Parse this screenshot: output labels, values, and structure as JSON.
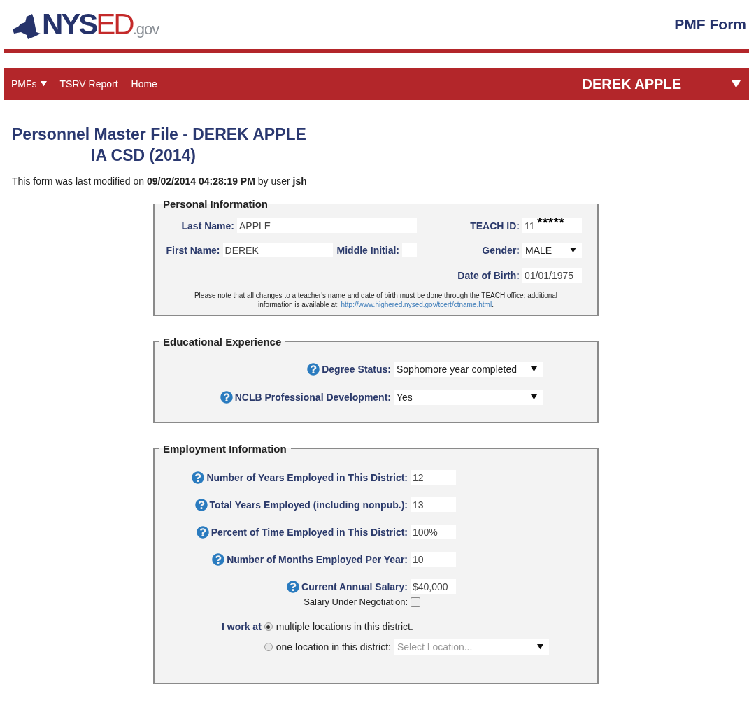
{
  "header": {
    "logo": {
      "part_1": "NYS",
      "part_2": "ED",
      "part_3": ".gov"
    },
    "page_title": "PMF Form"
  },
  "nav": {
    "items": [
      {
        "label": "PMFs",
        "has_menu": true
      },
      {
        "label": "TSRV Report",
        "has_menu": false
      },
      {
        "label": "Home",
        "has_menu": false
      }
    ],
    "user": {
      "name": "DEREK APPLE"
    }
  },
  "heading": {
    "lines": [
      "Personnel Master File - DEREK APPLE",
      "IA CSD (2014)"
    ]
  },
  "modified_note": "This form was last modified on **09/02/2014 04:28:19 PM** by user **jsh**",
  "personal": {
    "legend": "Personal Information",
    "last_name": {
      "label": "Last Name:",
      "value": "APPLE"
    },
    "first_name": {
      "label": "First Name:",
      "value": "DEREK"
    },
    "middle_initial": {
      "label": "Middle Initial:"
    },
    "teach_id": {
      "label": "TEACH ID:",
      "value": "11",
      "mask": "*****"
    },
    "gender": {
      "label": "Gender:",
      "value": "MALE"
    },
    "date_of_birth": {
      "label": "Date of Birth:",
      "value": "01/01/1975"
    },
    "note": "Please note that all changes to a teacher's name and date of birth must be done through the TEACH office; additional information is available at: ",
    "note_link": "http://www.highered.nysed.gov/tcert/ctname.html",
    "note_end": "."
  },
  "education": {
    "legend": "Educational Experience",
    "rows": [
      {
        "label": "Degree Status:",
        "value": "Sophomore year completed"
      },
      {
        "label": "NCLB Professional Development:",
        "value": "Yes"
      }
    ]
  },
  "employment": {
    "legend": "Employment Information",
    "rows": [
      {
        "label": "Number of Years Employed in This District:",
        "value": "12"
      },
      {
        "label": "Total Years Employed (including nonpub.):",
        "value": "13"
      },
      {
        "label": "Percent of Time Employed in This District:",
        "value": "100%"
      },
      {
        "label": "Number of Months Employed Per Year:",
        "value": "10"
      },
      {
        "label": "Current Annual Salary:",
        "value": "$40,000"
      }
    ],
    "negotiation": {
      "label": "Salary Under Negotiation:",
      "checked": false
    },
    "work_at": {
      "label": "I work at",
      "options": [
        {
          "label": "multiple locations in this district.",
          "selected": true
        },
        {
          "label": "one location in this district:",
          "selected": false,
          "select_placeholder": "Select Location..."
        }
      ]
    }
  }
}
